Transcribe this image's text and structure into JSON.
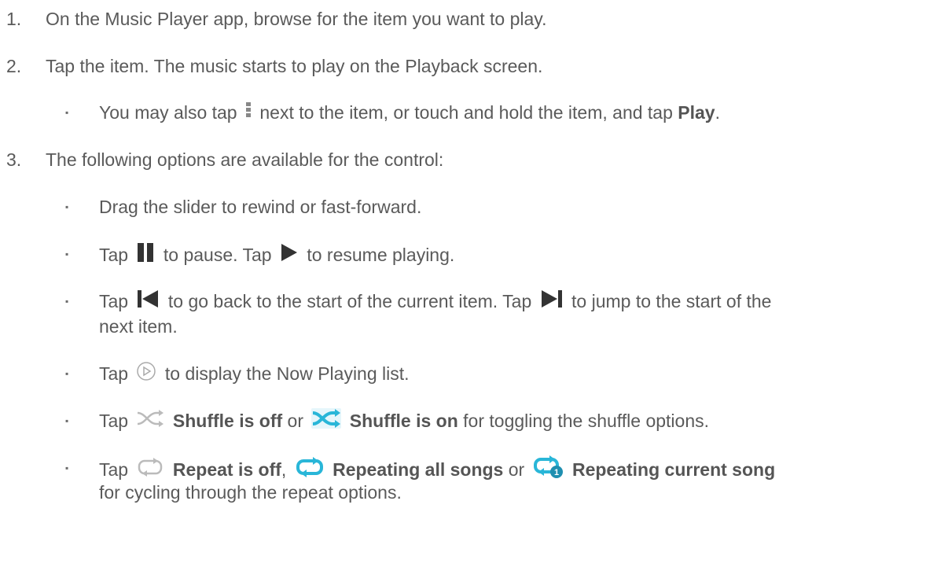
{
  "steps": [
    {
      "num": "1.",
      "text": "On the Music Player app, browse for the item you want to play."
    },
    {
      "num": "2.",
      "text": "Tap the item. The music starts to play on the Playback screen."
    },
    {
      "num": "3.",
      "text": "The following options are available for the control:"
    }
  ],
  "bullet_glyph": "▪",
  "sub_play": {
    "pre": "You may also tap",
    "mid": "next to the item, or touch and hold the item, and tap",
    "bold": "Play",
    "end": "."
  },
  "b_drag": "Drag the slider to rewind or fast-forward.",
  "b_pause": {
    "pre": "Tap",
    "mid": "to pause. Tap",
    "end": "to resume playing."
  },
  "b_skip": {
    "pre": "Tap",
    "mid": "to go back to the start of the current item. Tap",
    "end": "to jump to the start of the",
    "line2": "next item."
  },
  "b_nowplaying": {
    "pre": "Tap",
    "end": "to display the Now Playing list."
  },
  "b_shuffle": {
    "pre": "Tap",
    "off_label": "Shuffle is off",
    "or": "or",
    "on_label": "Shuffle is on",
    "end": "for toggling the shuffle options."
  },
  "b_repeat": {
    "pre": "Tap",
    "off_label": "Repeat is off",
    "comma": ",",
    "all_label": "Repeating all songs",
    "or": "or",
    "current_label": "Repeating current song",
    "line2": "for cycling through the repeat options."
  },
  "colors": {
    "text": "#5a5a5a",
    "accent_cyan": "#29b6d8",
    "icon_dark": "#333333",
    "icon_light": "#bbbbbb"
  },
  "icons": [
    "menu-icon",
    "pause-icon",
    "play-icon",
    "previous-icon",
    "next-icon",
    "now-playing-icon",
    "shuffle-off-icon",
    "shuffle-on-icon",
    "repeat-off-icon",
    "repeat-all-icon",
    "repeat-current-icon"
  ]
}
